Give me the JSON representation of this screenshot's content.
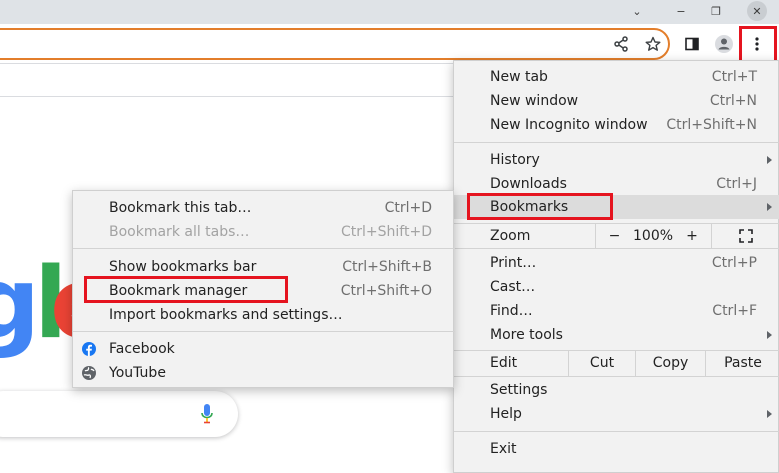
{
  "window_controls": {
    "minimize_glyph": "⌄",
    "restore_glyph": "−",
    "maximize_glyph": "❐",
    "close_glyph": "✕"
  },
  "toolbar": {
    "share_icon": "share-icon",
    "star_icon": "star-icon",
    "side_panel_icon": "side-panel-icon",
    "profile_icon": "profile-icon",
    "menu_icon": "kebab-menu-icon"
  },
  "google": {
    "logo_text": "gle"
  },
  "chrome_menu": {
    "new_tab": {
      "label": "New tab",
      "shortcut": "Ctrl+T"
    },
    "new_window": {
      "label": "New window",
      "shortcut": "Ctrl+N"
    },
    "new_incognito": {
      "label": "New Incognito window",
      "shortcut": "Ctrl+Shift+N"
    },
    "history": {
      "label": "History"
    },
    "downloads": {
      "label": "Downloads",
      "shortcut": "Ctrl+J"
    },
    "bookmarks": {
      "label": "Bookmarks"
    },
    "zoom": {
      "label": "Zoom",
      "minus": "−",
      "level": "100%",
      "plus": "+"
    },
    "print": {
      "label": "Print…",
      "shortcut": "Ctrl+P"
    },
    "cast": {
      "label": "Cast…"
    },
    "find": {
      "label": "Find…",
      "shortcut": "Ctrl+F"
    },
    "more_tools": {
      "label": "More tools"
    },
    "edit": {
      "label": "Edit",
      "cut": "Cut",
      "copy": "Copy",
      "paste": "Paste"
    },
    "settings": {
      "label": "Settings"
    },
    "help": {
      "label": "Help"
    },
    "exit": {
      "label": "Exit"
    }
  },
  "bookmarks_menu": {
    "bookmark_tab": {
      "label": "Bookmark this tab…",
      "shortcut": "Ctrl+D"
    },
    "bookmark_all": {
      "label": "Bookmark all tabs…",
      "shortcut": "Ctrl+Shift+D"
    },
    "show_bar": {
      "label": "Show bookmarks bar",
      "shortcut": "Ctrl+Shift+B"
    },
    "manager": {
      "label": "Bookmark manager",
      "shortcut": "Ctrl+Shift+O"
    },
    "import": {
      "label": "Import bookmarks and settings…"
    },
    "items": [
      {
        "label": "Facebook",
        "icon": "facebook-icon"
      },
      {
        "label": "YouTube",
        "icon": "globe-icon"
      }
    ]
  },
  "colors": {
    "highlight": "#e5141f",
    "omnibox_border": "#e37e2b",
    "facebook_blue": "#1877f2"
  }
}
